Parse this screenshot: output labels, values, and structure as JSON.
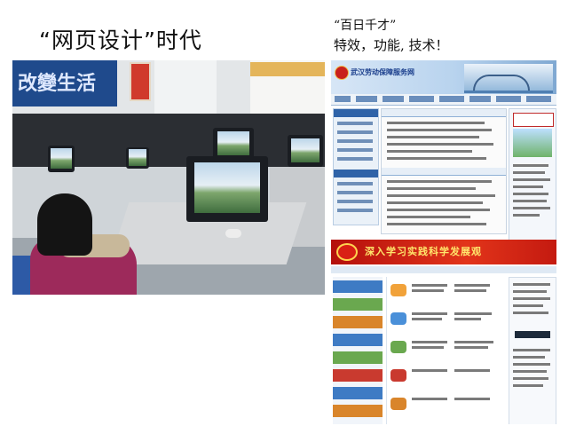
{
  "slide": {
    "left_title": "“网页设计”时代",
    "right_title_line1": "“百日千才”",
    "right_title_line2": "特效，功能, 技术！"
  },
  "photo": {
    "banner_text": "改變生活"
  },
  "website": {
    "site_name": "武汉劳动保障服务网",
    "promo_banner": "深入学习实践科学发展观"
  }
}
